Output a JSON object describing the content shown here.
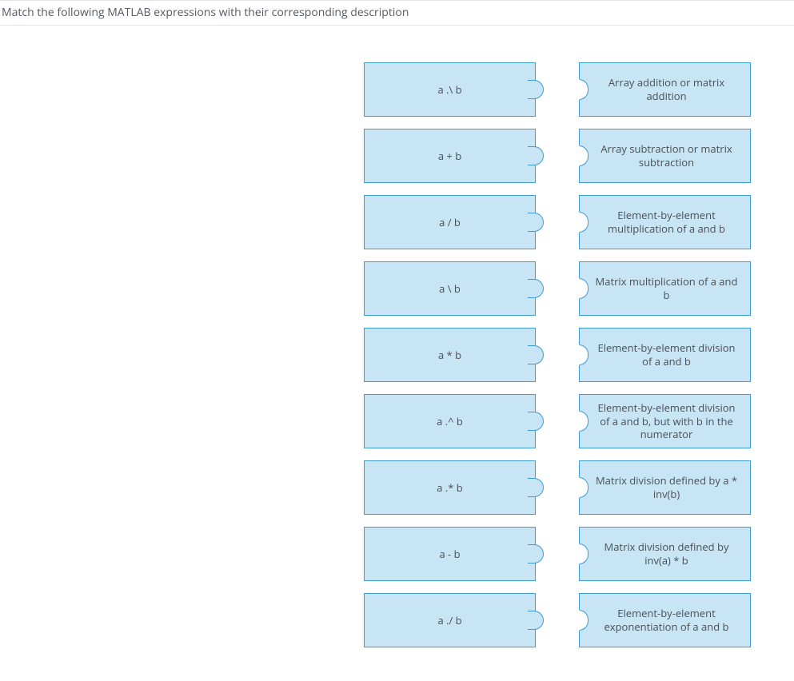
{
  "prompt": "Match the following MATLAB expressions with their corresponding description",
  "left_items": [
    "a .\\ b",
    "a + b",
    "a / b",
    "a \\ b",
    "a * b",
    "a .^ b",
    "a .* b",
    "a - b",
    "a ./ b"
  ],
  "right_items": [
    "Array addition or matrix addition",
    "Array subtraction or matrix subtraction",
    "Element-by-element multiplication of a and b",
    "Matrix multiplication of a and b",
    "Element-by-element division of a and b",
    "Element-by-element division of a and b, but with b in the numerator",
    "Matrix division defined by a * inv(b)",
    "Matrix division defined by inv(a) * b",
    "Element-by-element exponentiation of a and b"
  ]
}
